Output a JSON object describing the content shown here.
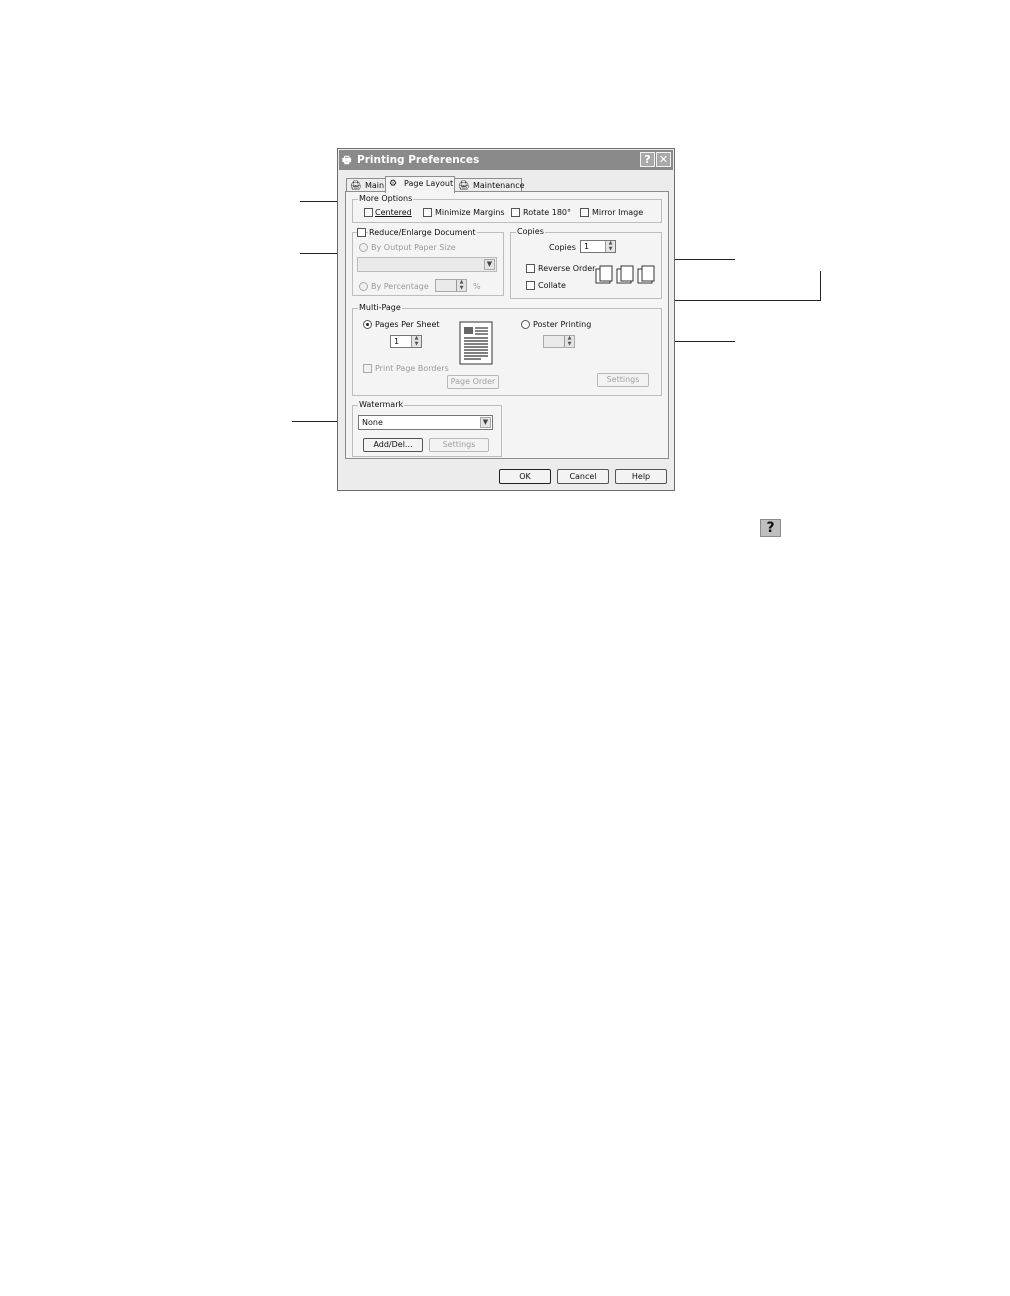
{
  "window": {
    "title": "Printing Preferences",
    "help_glyph": "?",
    "close_glyph": "✕"
  },
  "tabs": [
    {
      "label": "Main",
      "icon": "printer-icon"
    },
    {
      "label": "Page Layout",
      "icon": "page-layout-icon"
    },
    {
      "label": "Maintenance",
      "icon": "maintenance-icon"
    }
  ],
  "more_options": {
    "label": "More Options",
    "centered": "Centered",
    "minimize_margins": "Minimize Margins",
    "rotate": "Rotate 180°",
    "mirror": "Mirror Image"
  },
  "reduce": {
    "label": "Reduce/Enlarge Document",
    "by_output": "By Output Paper Size",
    "by_percentage": "By Percentage",
    "percent_sign": "%"
  },
  "copies": {
    "label": "Copies",
    "copies_label": "Copies",
    "copies_value": "1",
    "reverse_order": "Reverse Order",
    "collate": "Collate"
  },
  "multi_page": {
    "label": "Multi-Page",
    "pages_per_sheet": "Pages Per Sheet",
    "pages_value": "1",
    "poster_printing": "Poster Printing",
    "print_page_borders": "Print Page Borders",
    "page_order": "Page Order",
    "settings": "Settings"
  },
  "watermark": {
    "label": "Watermark",
    "selected": "None",
    "add_del": "Add/Del...",
    "settings": "Settings"
  },
  "footer": {
    "ok": "OK",
    "cancel": "Cancel",
    "help": "Help"
  },
  "help_icon_glyph": "?"
}
